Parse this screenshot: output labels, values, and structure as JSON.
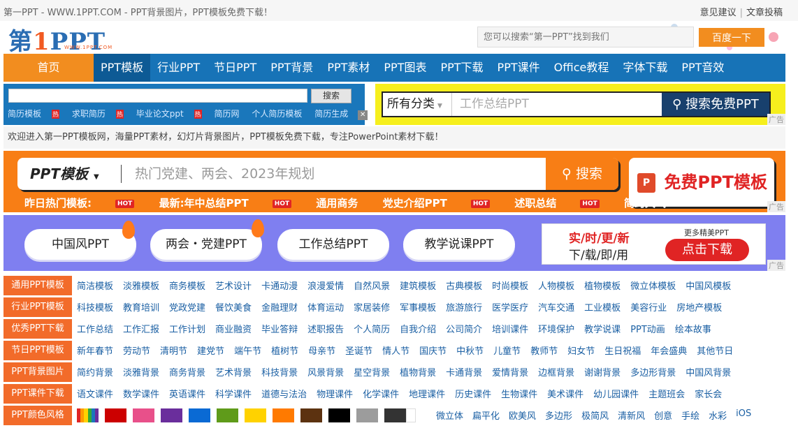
{
  "topbar": {
    "title": "第一PPT - WWW.1PPT.COM - PPT背景图片，PPT模板免费下载！",
    "feedback": "意见建议",
    "sep": "|",
    "submit": "文章投稿"
  },
  "logo": {
    "prefix": "第",
    "one": "1",
    "suffix": "PPT",
    "url": "WWW.1PPT.COM"
  },
  "header_search": {
    "placeholder": "您可以搜索“第一PPT”找到我们",
    "button": "百度一下"
  },
  "nav": {
    "home": "首页",
    "items": [
      "PPT模板",
      "行业PPT",
      "节日PPT",
      "PPT背景",
      "PPT素材",
      "PPT图表",
      "PPT下载",
      "PPT课件",
      "Office教程",
      "字体下载",
      "PPT音效"
    ]
  },
  "left_search": {
    "button": "搜索",
    "links": [
      "简历模板",
      "求职简历",
      "毕业论文ppt",
      "简历网",
      "个人简历模板",
      "简历生成"
    ],
    "hot": "热"
  },
  "right_search": {
    "category": "所有分类",
    "placeholder": "工作总结PPT",
    "button": "搜索免费PPT",
    "ad": "广告"
  },
  "welcome": "欢迎进入第一PPT模板网，海量PPT素材，幻灯片背景图片，PPT模板免费下载，专注PowerPoint素材下载！",
  "big_search": {
    "category": "PPT模板",
    "placeholder": "热门党建、两会、2023年规划",
    "button": "搜索",
    "free_button": "免费PPT模板",
    "ppt_icon": "P"
  },
  "hot_row": {
    "yesterday": "昨日热门模板:",
    "latest": "最新:年中总结PPT",
    "items": [
      "通用商务",
      "党史介绍PPT",
      "述职总结",
      "简约大气PPT"
    ],
    "hot": "HOT"
  },
  "pills": [
    "中国风PPT",
    "两会・党建PPT",
    "工作总结PPT",
    "教学说课PPT"
  ],
  "banner": {
    "line1": "实/时/更/新",
    "line2": "下/载/即/用",
    "more": "更多精美PPT",
    "download": "点击下载"
  },
  "categories": [
    {
      "label": "通用PPT模板",
      "items": [
        "简洁模板",
        "淡雅模板",
        "商务模板",
        "艺术设计",
        "卡通动漫",
        "浪漫爱情",
        "自然风景",
        "建筑模板",
        "古典模板",
        "时尚模板",
        "人物模板",
        "植物模板",
        "微立体模板",
        "中国风模板"
      ]
    },
    {
      "label": "行业PPT模板",
      "items": [
        "科技模板",
        "教育培训",
        "党政党建",
        "餐饮美食",
        "金融理财",
        "体育运动",
        "家居装修",
        "军事模板",
        "旅游旅行",
        "医学医疗",
        "汽车交通",
        "工业模板",
        "美容行业",
        "房地产模板"
      ]
    },
    {
      "label": "优秀PPT下载",
      "items": [
        "工作总结",
        "工作汇报",
        "工作计划",
        "商业融资",
        "毕业答辩",
        "述职报告",
        "个人简历",
        "自我介绍",
        "公司简介",
        "培训课件",
        "环境保护",
        "教学说课",
        "PPT动画",
        "绘本故事"
      ]
    },
    {
      "label": "节日PPT模板",
      "items": [
        "新年春节",
        "劳动节",
        "清明节",
        "建党节",
        "端午节",
        "植树节",
        "母亲节",
        "圣诞节",
        "情人节",
        "国庆节",
        "中秋节",
        "儿童节",
        "教师节",
        "妇女节",
        "生日祝福",
        "年会盛典",
        "其他节日"
      ]
    },
    {
      "label": "PPT背景图片",
      "items": [
        "简约背景",
        "淡雅背景",
        "商务背景",
        "艺术背景",
        "科技背景",
        "风景背景",
        "星空背景",
        "植物背景",
        "卡通背景",
        "爱情背景",
        "边框背景",
        "谢谢背景",
        "多边形背景",
        "中国风背景"
      ]
    },
    {
      "label": "PPT课件下载",
      "items": [
        "语文课件",
        "数学课件",
        "英语课件",
        "科学课件",
        "道德与法治",
        "物理课件",
        "化学课件",
        "地理课件",
        "历史课件",
        "生物课件",
        "美术课件",
        "幼儿园课件",
        "主题班会",
        "家长会"
      ]
    }
  ],
  "color_row": {
    "label": "PPT颜色风格",
    "colors": [
      "#cc0000",
      "#e8508a",
      "#6a2e9c",
      "#0a6ad4",
      "#5f9b1a",
      "#ffd200",
      "#ff7a00",
      "#5c3210",
      "#000000",
      "#9c9c9c",
      "#333333"
    ],
    "styles": [
      "微立体",
      "扁平化",
      "欧美风",
      "多边形",
      "极简风",
      "清新风",
      "创意",
      "手绘",
      "水彩",
      "iOS"
    ]
  }
}
